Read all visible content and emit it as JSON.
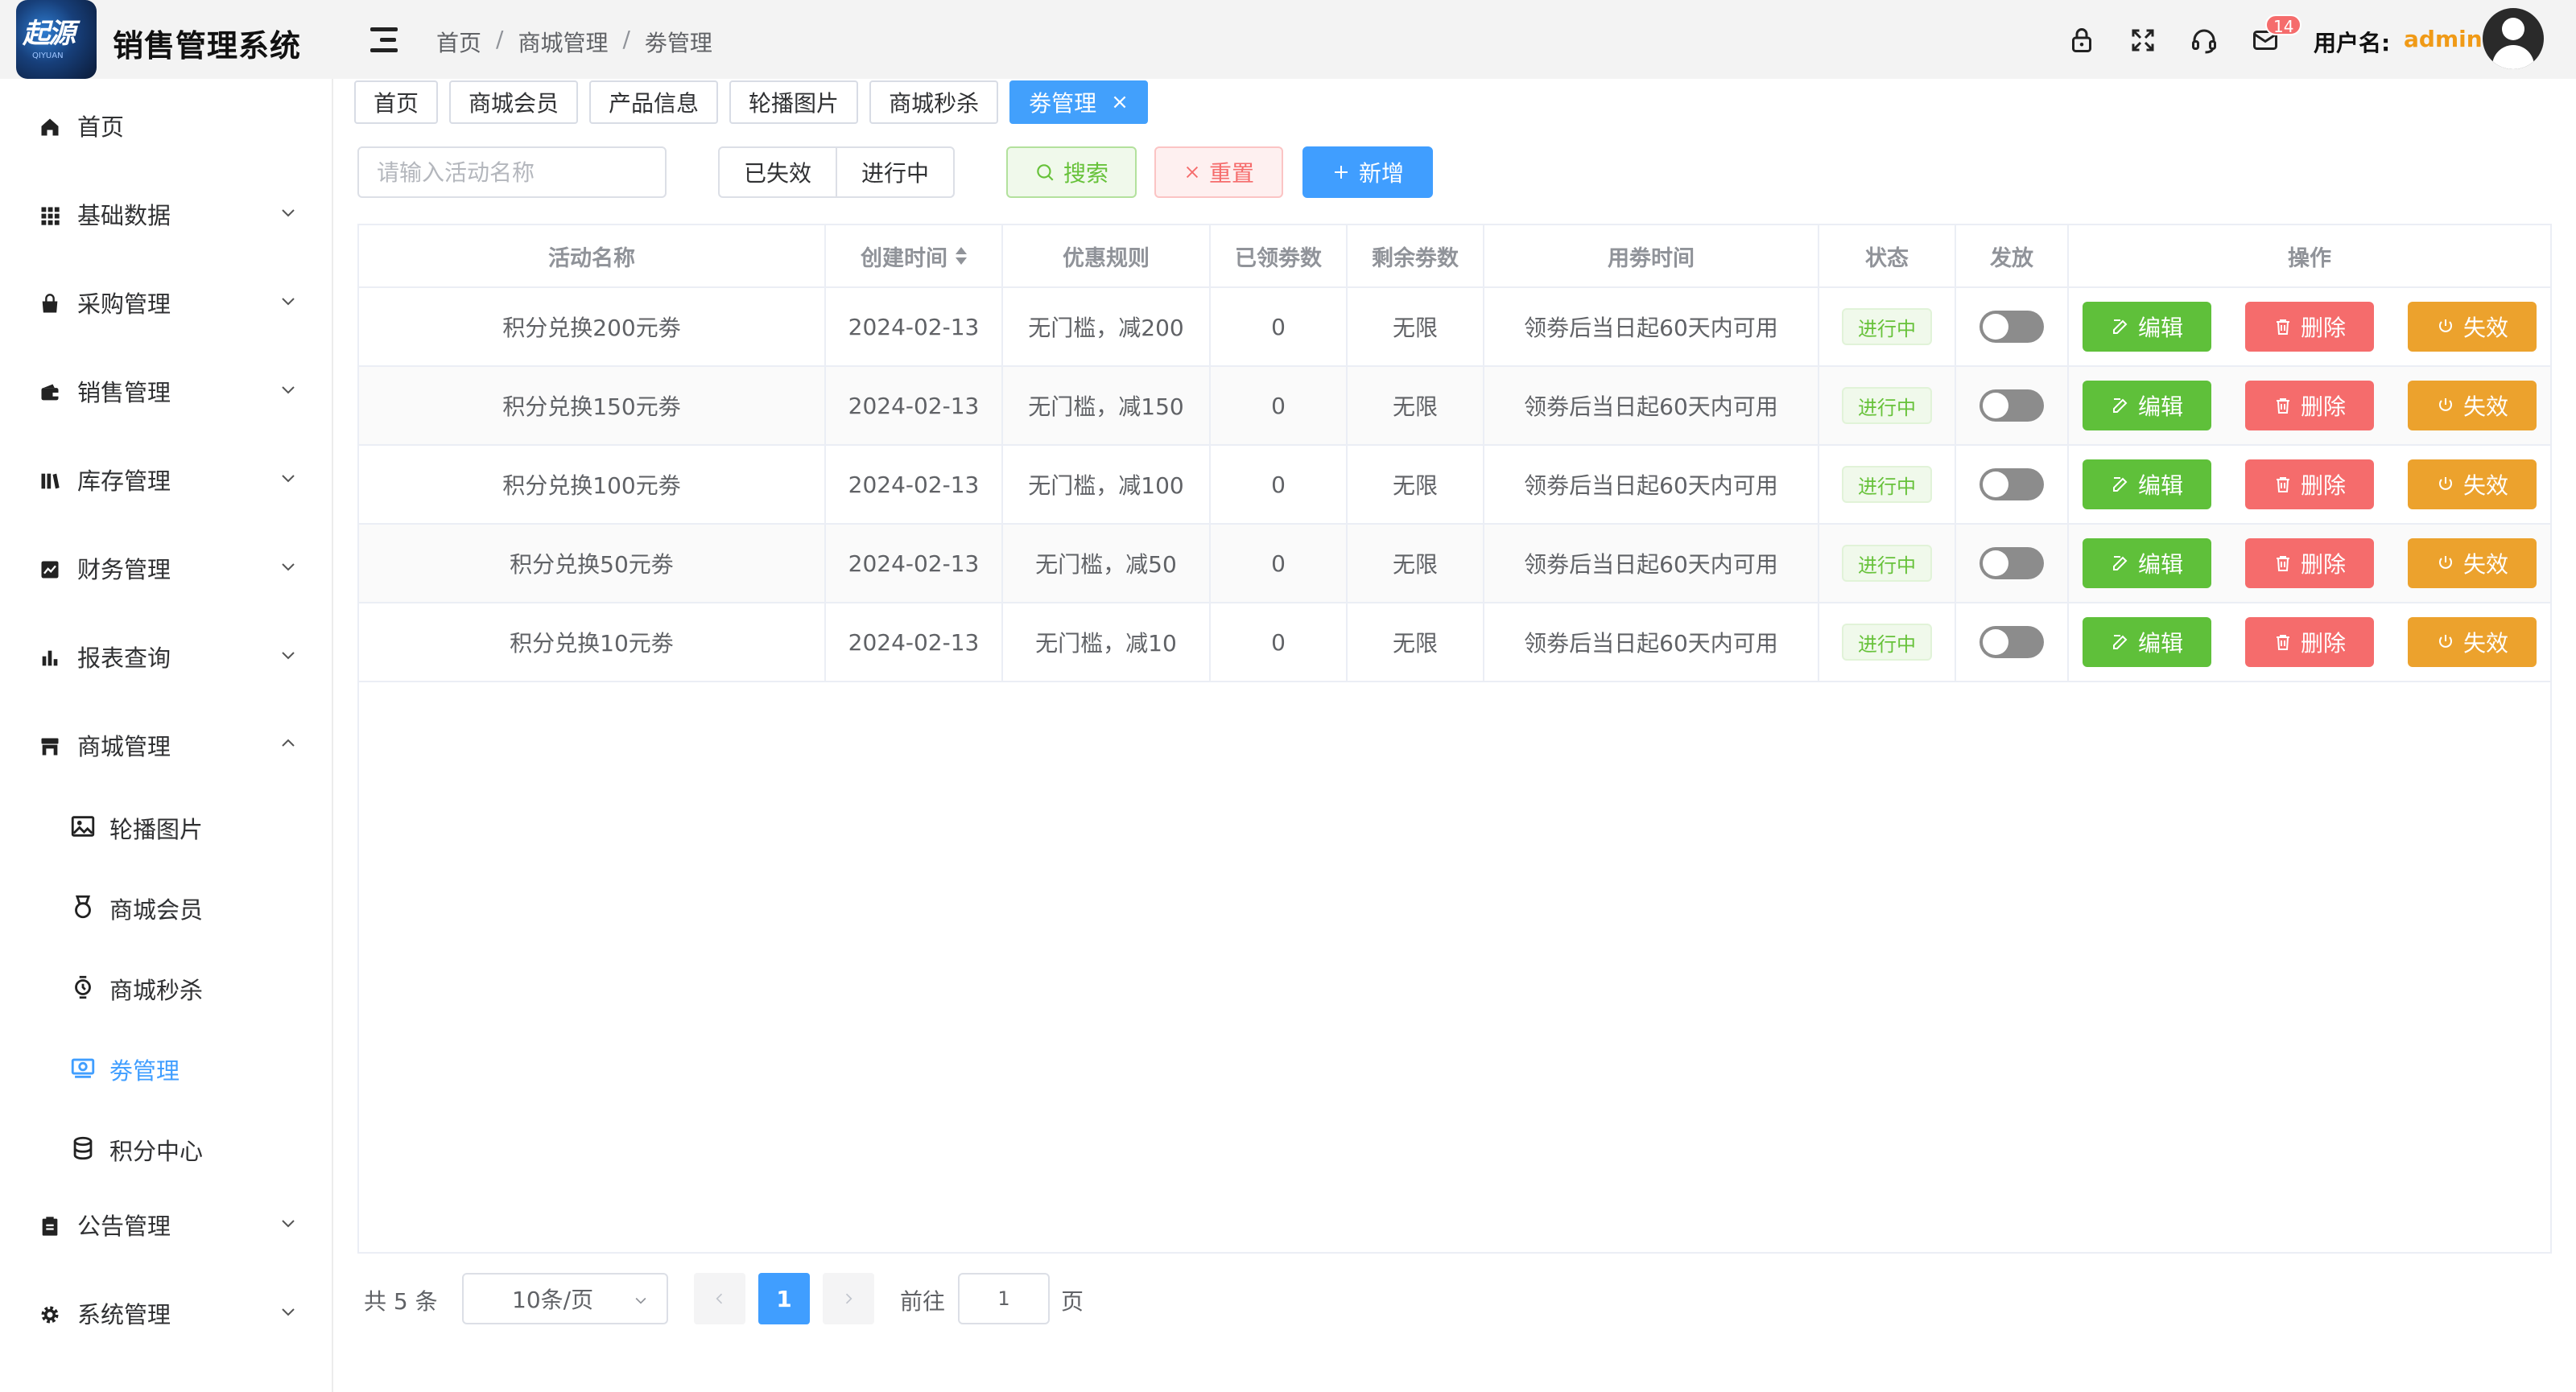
{
  "header": {
    "logo_text": "起源",
    "logo_sub": "QIYUAN",
    "app_title": "销售管理系统",
    "breadcrumb": [
      "首页",
      "商城管理",
      "劵管理"
    ],
    "notification_count": "14",
    "user_label": "用户名:",
    "user_name": "admin"
  },
  "sidebar": {
    "items": [
      {
        "label": "首页",
        "icon": "home-icon"
      },
      {
        "label": "基础数据",
        "icon": "grid-icon"
      },
      {
        "label": "采购管理",
        "icon": "bag-icon"
      },
      {
        "label": "销售管理",
        "icon": "wallet-icon"
      },
      {
        "label": "库存管理",
        "icon": "books-icon"
      },
      {
        "label": "财务管理",
        "icon": "trend-icon"
      },
      {
        "label": "报表查询",
        "icon": "bar-chart-icon"
      },
      {
        "label": "商城管理",
        "icon": "shop-icon"
      }
    ],
    "sub_items": [
      {
        "label": "轮播图片",
        "icon": "picture-icon"
      },
      {
        "label": "商城会员",
        "icon": "medal-icon"
      },
      {
        "label": "商城秒杀",
        "icon": "watch-icon"
      },
      {
        "label": "劵管理",
        "icon": "coupon-icon"
      },
      {
        "label": "积分中心",
        "icon": "coins-icon"
      }
    ],
    "bottom_items": [
      {
        "label": "公告管理",
        "icon": "clipboard-icon"
      },
      {
        "label": "系统管理",
        "icon": "gear-icon"
      }
    ]
  },
  "tags": [
    "首页",
    "商城会员",
    "产品信息",
    "轮播图片",
    "商城秒杀",
    "劵管理"
  ],
  "filter": {
    "search_placeholder": "请输入活动名称",
    "segments": [
      "已失效",
      "进行中"
    ],
    "search_label": "搜索",
    "reset_label": "重置",
    "add_label": "新增"
  },
  "table": {
    "columns": [
      "活动名称",
      "创建时间",
      "优惠规则",
      "已领劵数",
      "剩余劵数",
      "用劵时间",
      "状态",
      "发放",
      "操作"
    ],
    "rows": [
      {
        "name": "积分兑换200元劵",
        "created": "2024-02-13",
        "rule": "无门槛，减200",
        "claimed": "0",
        "remaining": "无限",
        "usage": "领劵后当日起60天内可用",
        "status": "进行中",
        "issued": false
      },
      {
        "name": "积分兑换150元劵",
        "created": "2024-02-13",
        "rule": "无门槛，减150",
        "claimed": "0",
        "remaining": "无限",
        "usage": "领劵后当日起60天内可用",
        "status": "进行中",
        "issued": false
      },
      {
        "name": "积分兑换100元劵",
        "created": "2024-02-13",
        "rule": "无门槛，减100",
        "claimed": "0",
        "remaining": "无限",
        "usage": "领劵后当日起60天内可用",
        "status": "进行中",
        "issued": false
      },
      {
        "name": "积分兑换50元劵",
        "created": "2024-02-13",
        "rule": "无门槛，减50",
        "claimed": "0",
        "remaining": "无限",
        "usage": "领劵后当日起60天内可用",
        "status": "进行中",
        "issued": false
      },
      {
        "name": "积分兑换10元劵",
        "created": "2024-02-13",
        "rule": "无门槛，减10",
        "claimed": "0",
        "remaining": "无限",
        "usage": "领劵后当日起60天内可用",
        "status": "进行中",
        "issued": false
      }
    ],
    "actions": {
      "edit": "编辑",
      "delete": "删除",
      "disable": "失效"
    }
  },
  "pagination": {
    "total": "共 5 条",
    "page_size": "10条/页",
    "current_page": "1",
    "goto_label": "前往",
    "goto_value": "1",
    "page_suffix": "页"
  },
  "colors": {
    "primary": "#409eff",
    "success": "#5fc03a",
    "danger": "#f56c6c",
    "warning": "#eca22d",
    "username": "#f09a16"
  }
}
